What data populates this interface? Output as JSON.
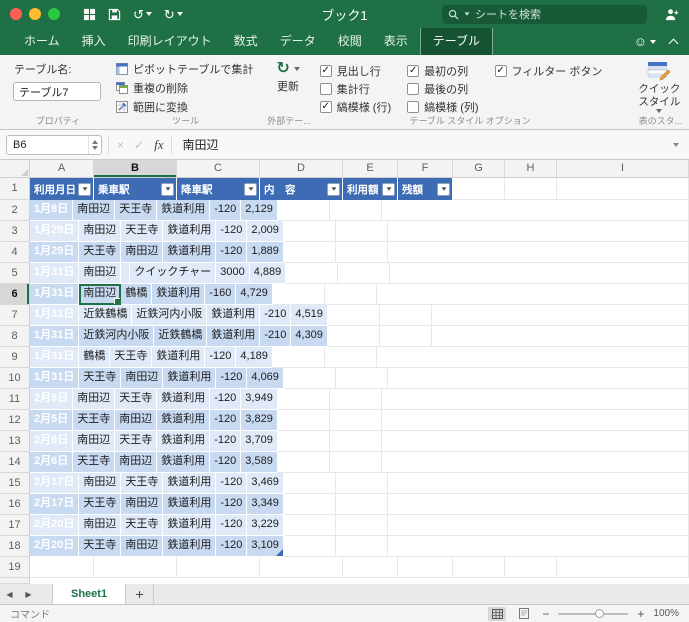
{
  "titlebar": {
    "title": "ブック1",
    "search_placeholder": "シートを検索"
  },
  "ribbon_tabs": [
    {
      "id": "home",
      "label": "ホーム",
      "active": false
    },
    {
      "id": "insert",
      "label": "挿入",
      "active": false
    },
    {
      "id": "page-layout",
      "label": "印刷レイアウト",
      "active": false
    },
    {
      "id": "formulas",
      "label": "数式",
      "active": false
    },
    {
      "id": "data",
      "label": "データ",
      "active": false
    },
    {
      "id": "review",
      "label": "校閲",
      "active": false
    },
    {
      "id": "view",
      "label": "表示",
      "active": false
    },
    {
      "id": "table",
      "label": "テーブル",
      "active": true
    }
  ],
  "ribbon": {
    "table_name_label": "テーブル名:",
    "table_name_value": "テーブル7",
    "tools": [
      {
        "id": "summarize-with-pivottable",
        "label": "ピボットテーブルで集計"
      },
      {
        "id": "remove-duplicates",
        "label": "重複の削除"
      },
      {
        "id": "convert-to-range",
        "label": "範囲に変換"
      }
    ],
    "refresh_label": "更新",
    "style_options": [
      {
        "label": "見出し行",
        "checked": true
      },
      {
        "label": "集計行",
        "checked": false
      },
      {
        "label": "縞模様 (行)",
        "checked": true
      },
      {
        "label": "最初の列",
        "checked": true
      },
      {
        "label": "最後の列",
        "checked": false
      },
      {
        "label": "縞模様 (列)",
        "checked": false
      },
      {
        "label": "フィルター ボタン",
        "checked": true
      }
    ],
    "quick_style_label": "クイック スタイル",
    "groups": {
      "properties": "プロパティ",
      "tools": "ツール",
      "external": "外部テー...",
      "style_options": "テーブル スタイル オプション",
      "table_styles": "表のスタ..."
    }
  },
  "formula_bar": {
    "name_box": "B6",
    "cancel": "×",
    "enter": "✓",
    "fx": "fx",
    "content": "南田辺"
  },
  "grid": {
    "columns": [
      "A",
      "B",
      "C",
      "D",
      "E",
      "F",
      "G",
      "H",
      "I"
    ],
    "visible_rows": 19,
    "selected": {
      "col": "B",
      "row": 6,
      "cell": "B6"
    },
    "table": {
      "headers": [
        "利用月日",
        "乗車駅",
        "降車駅",
        "内　容",
        "利用額",
        "残額"
      ],
      "rows": [
        [
          "1月8日",
          "南田辺",
          "天王寺",
          "鉄道利用",
          "-120",
          "2,129"
        ],
        [
          "1月29日",
          "南田辺",
          "天王寺",
          "鉄道利用",
          "-120",
          "2,009"
        ],
        [
          "1月29日",
          "天王寺",
          "南田辺",
          "鉄道利用",
          "-120",
          "1,889"
        ],
        [
          "1月31日",
          "南田辺",
          "",
          "クイックチャー",
          "3000",
          "4,889"
        ],
        [
          "1月31日",
          "南田辺",
          "鶴橋",
          "鉄道利用",
          "-160",
          "4,729"
        ],
        [
          "1月31日",
          "近鉄鶴橋",
          "近鉄河内小阪",
          "鉄道利用",
          "-210",
          "4,519"
        ],
        [
          "1月31日",
          "近鉄河内小阪",
          "近鉄鶴橋",
          "鉄道利用",
          "-210",
          "4,309"
        ],
        [
          "1月31日",
          "鶴橋",
          "天王寺",
          "鉄道利用",
          "-120",
          "4,189"
        ],
        [
          "1月31日",
          "天王寺",
          "南田辺",
          "鉄道利用",
          "-120",
          "4,069"
        ],
        [
          "2月5日",
          "南田辺",
          "天王寺",
          "鉄道利用",
          "-120",
          "3,949"
        ],
        [
          "2月5日",
          "天王寺",
          "南田辺",
          "鉄道利用",
          "-120",
          "3,829"
        ],
        [
          "2月6日",
          "南田辺",
          "天王寺",
          "鉄道利用",
          "-120",
          "3,709"
        ],
        [
          "2月6日",
          "天王寺",
          "南田辺",
          "鉄道利用",
          "-120",
          "3,589"
        ],
        [
          "2月17日",
          "南田辺",
          "天王寺",
          "鉄道利用",
          "-120",
          "3,469"
        ],
        [
          "2月17日",
          "天王寺",
          "南田辺",
          "鉄道利用",
          "-120",
          "3,349"
        ],
        [
          "2月20日",
          "南田辺",
          "天王寺",
          "鉄道利用",
          "-120",
          "3,229"
        ],
        [
          "2月20日",
          "天王寺",
          "南田辺",
          "鉄道利用",
          "-120",
          "3,109"
        ]
      ]
    }
  },
  "sheet_bar": {
    "nav_left": "◀",
    "nav_right": "▶",
    "sheet_name": "Sheet1",
    "add_sheet": "+"
  },
  "status_bar": {
    "left": "コマンド",
    "zoom_minus": "−",
    "zoom_plus": "+",
    "zoom_level": "100%"
  },
  "icons": {
    "check": "✓",
    "undo": "↺",
    "redo": "↻",
    "refresh": "↻",
    "smiley": "☺"
  },
  "colors": {
    "accent_green": "#1f7145",
    "selection_green": "#1e7145",
    "table_header_blue": "#3d6cb4",
    "band_dark": "#c8daf1",
    "band_light": "#dfe9f7"
  }
}
